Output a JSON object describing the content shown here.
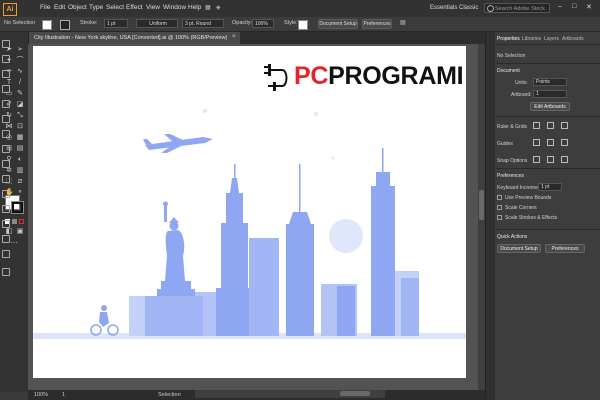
{
  "app": {
    "logo": "Ai",
    "menu": [
      "File",
      "Edit",
      "Object",
      "Type",
      "Select",
      "Effect",
      "View",
      "Window",
      "Help"
    ],
    "workspace": "Essentials Classic",
    "search_placeholder": "Search Adobe Stock",
    "window_controls": [
      "minimize-icon",
      "maximize-icon",
      "close-icon"
    ]
  },
  "control_bar": {
    "selection_label": "No Selection",
    "stroke_label": "Stroke:",
    "stroke_value": "1 pt",
    "uniform_label": "Uniform",
    "brush_value": "3 pt. Round",
    "opacity_label": "Opacity:",
    "opacity_value": "100%",
    "style_label": "Style:",
    "doc_setup_button": "Document Setup",
    "preferences_button": "Preferences"
  },
  "document_tab": {
    "title": "City Illustration - New York skyline, USA [Converted].ai @ 100% (RGB/Preview)",
    "close": "×"
  },
  "status_bar": {
    "zoom": "100%",
    "page": "1",
    "tool": "Selection"
  },
  "artwork": {
    "logo_text_accent": "PC",
    "logo_text_main": "PROGRAMI",
    "accent_color": "#e8232a",
    "skyline_color": "#8fa6f2"
  },
  "properties_panel": {
    "tabs": [
      "Properties",
      "Libraries",
      "Layers",
      "Artboards"
    ],
    "selection": "No Selection",
    "document_heading": "Document",
    "units_label": "Units:",
    "units_value": "Points",
    "artboard_label": "Artboard:",
    "artboard_value": "1",
    "edit_artboards_button": "Edit Artboards",
    "rulers_heading": "Ruler & Grids",
    "guides_heading": "Guides",
    "snap_heading": "Snap Options",
    "preferences_heading": "Preferences",
    "keyboard_increment_label": "Keyboard Increment:",
    "keyboard_increment_value": "1 pt",
    "use_preview_bounds": "Use Preview Bounds",
    "scale_corners": "Scale Corners",
    "scale_strokes": "Scale Strokes & Effects",
    "quick_actions_heading": "Quick Actions",
    "doc_setup_button": "Document Setup",
    "preferences_button": "Preferences"
  }
}
